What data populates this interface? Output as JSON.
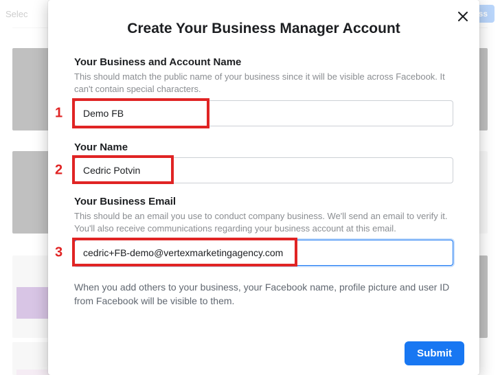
{
  "background": {
    "left_label": "Selec",
    "right_button": "ess"
  },
  "modal": {
    "title": "Create Your Business Manager Account",
    "fields": {
      "business_name": {
        "label": "Your Business and Account Name",
        "help": "This should match the public name of your business since it will be visible across Facebook. It can't contain special characters.",
        "value": "Demo FB"
      },
      "your_name": {
        "label": "Your Name",
        "value": "Cedric Potvin"
      },
      "business_email": {
        "label": "Your Business Email",
        "help": "This should be an email you use to conduct company business. We'll send an email to verify it. You'll also receive communications regarding your business account at this email.",
        "value": "cedric+FB-demo@vertexmarketingagency.com"
      }
    },
    "footer_note": "When you add others to your business, your Facebook name, profile picture and user ID from Facebook will be visible to them.",
    "submit_label": "Submit"
  },
  "annotations": {
    "n1": "1",
    "n2": "2",
    "n3": "3"
  }
}
